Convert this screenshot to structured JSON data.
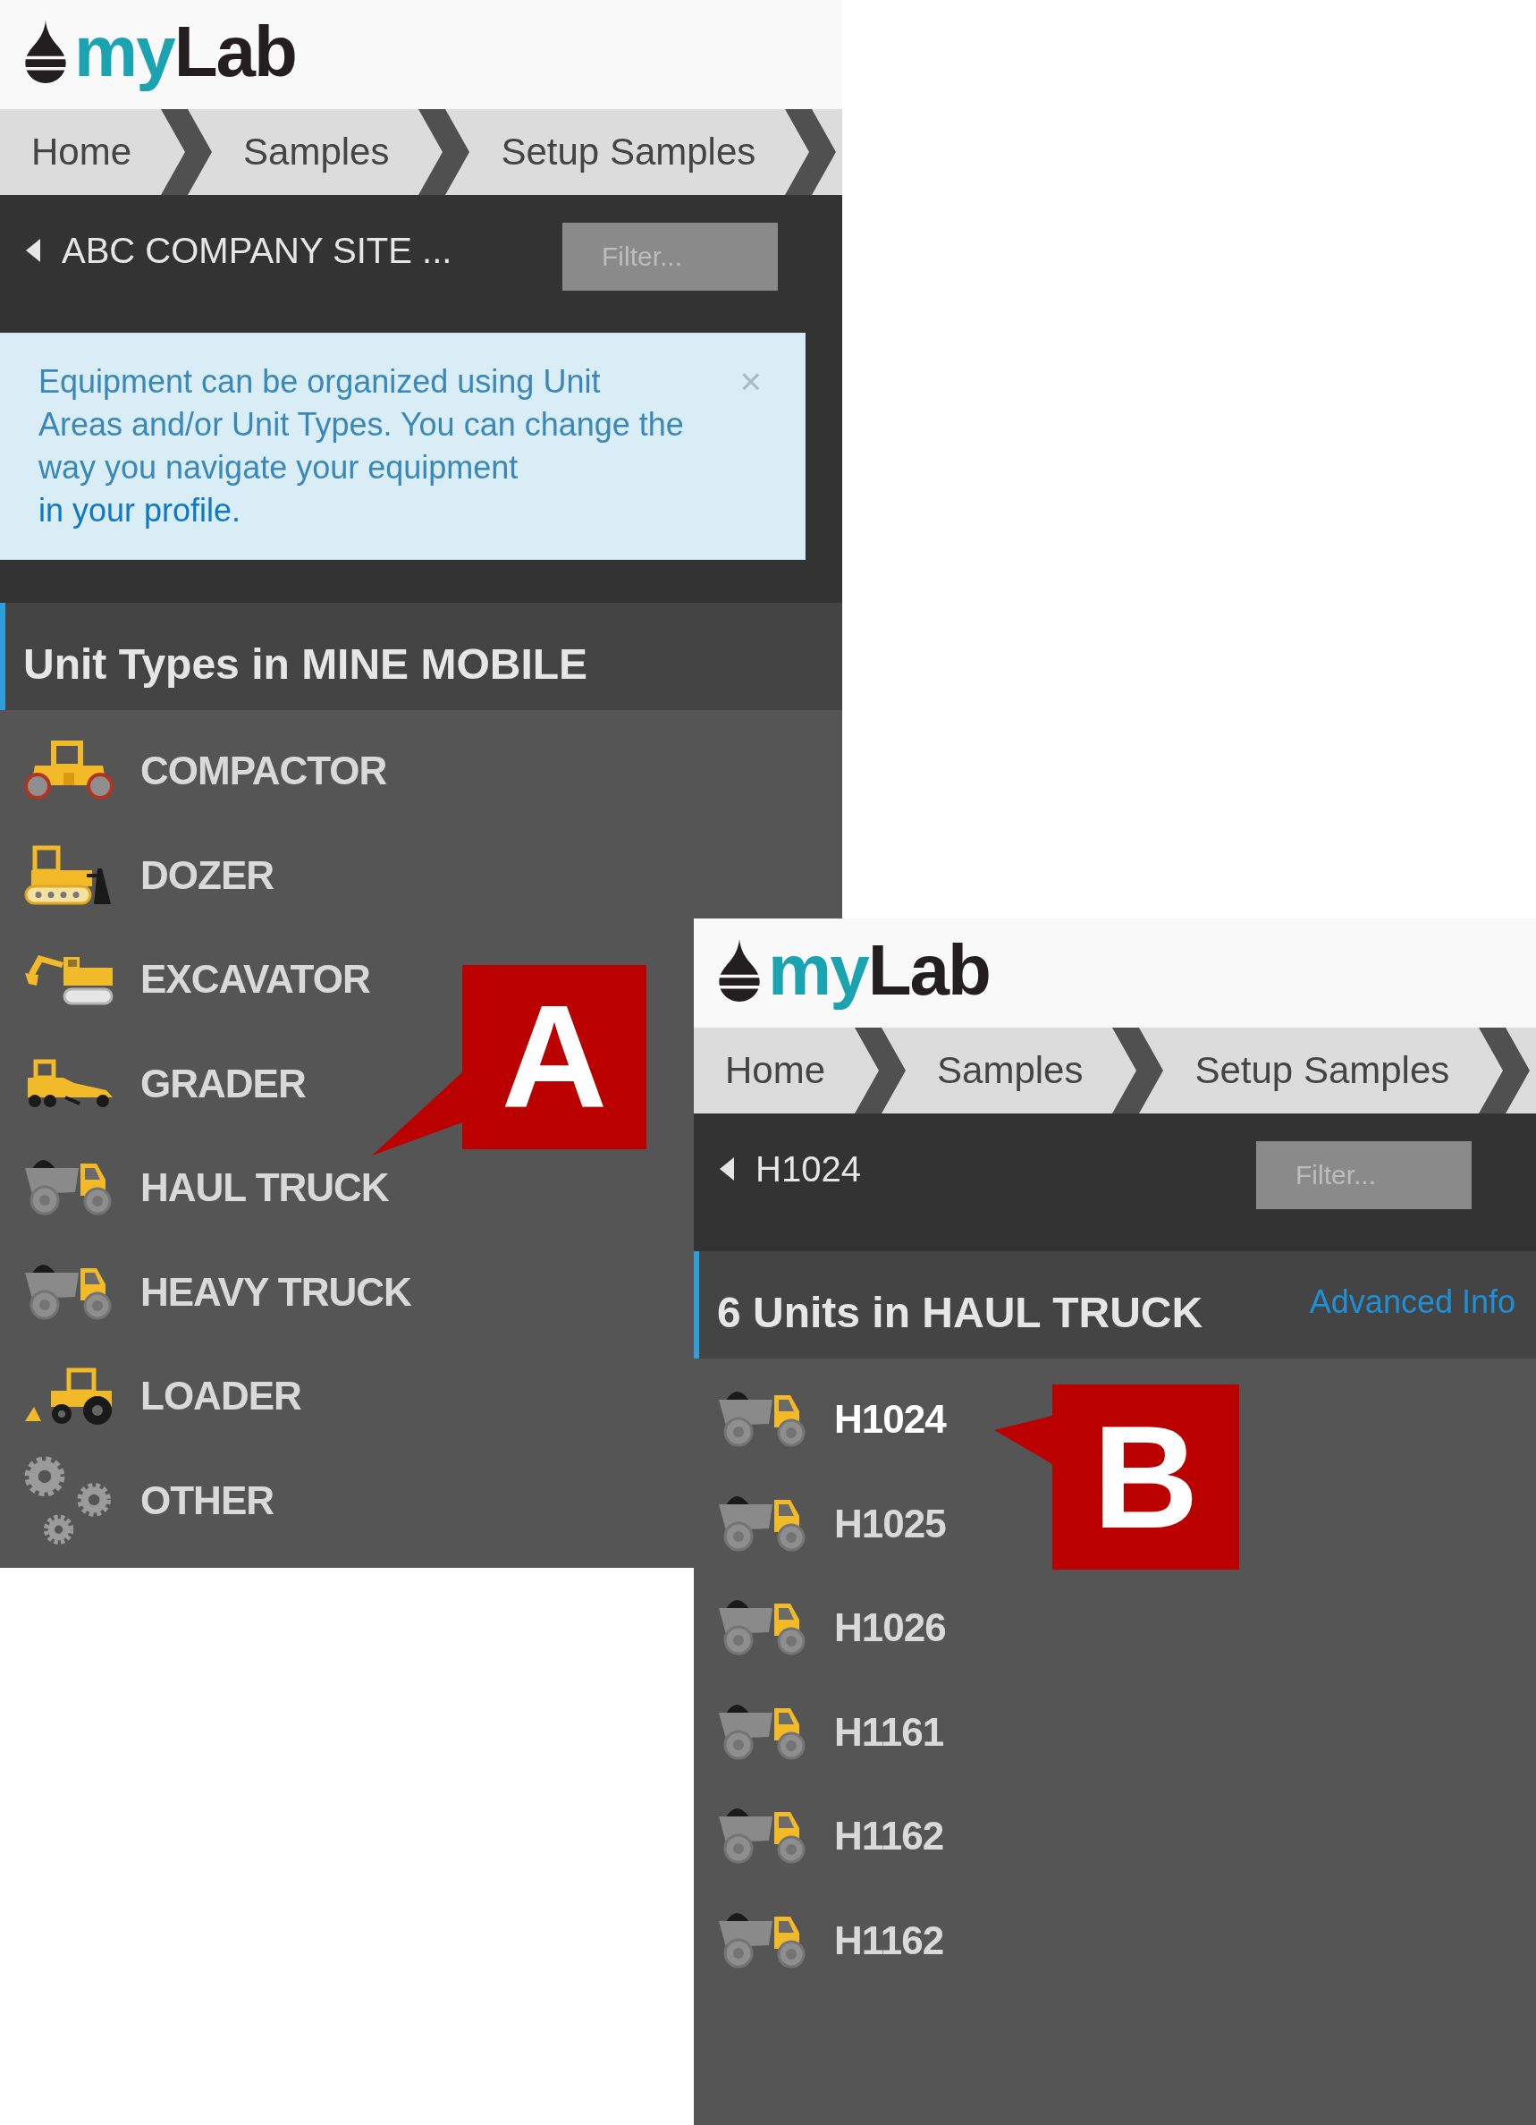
{
  "panels": [
    {
      "logo": {
        "prefix": "my",
        "name": "Lab"
      },
      "breadcrumb": [
        "Home",
        "Samples",
        "Setup Samples"
      ],
      "back_link": "ABC COMPANY SITE ...",
      "filter": {
        "placeholder": "Filter..."
      },
      "info": {
        "text": "Equipment can be organized using Unit Areas and/or Unit Types. You can change the way you navigate your equipment",
        "link": "in your profile.",
        "close": "×"
      },
      "list_header": {
        "title": "Unit Types in MINE MOBILE"
      },
      "items": [
        {
          "label": "COMPACTOR",
          "kind": "compactor",
          "selected": false
        },
        {
          "label": "DOZER",
          "kind": "dozer",
          "selected": false
        },
        {
          "label": "EXCAVATOR",
          "kind": "excavator",
          "selected": false
        },
        {
          "label": "GRADER",
          "kind": "grader",
          "selected": false
        },
        {
          "label": "HAUL TRUCK",
          "kind": "truck",
          "selected": false
        },
        {
          "label": "HEAVY TRUCK",
          "kind": "truck",
          "selected": false
        },
        {
          "label": "LOADER",
          "kind": "loader",
          "selected": false
        },
        {
          "label": "OTHER",
          "kind": "gears",
          "selected": false
        }
      ]
    },
    {
      "logo": {
        "prefix": "my",
        "name": "Lab"
      },
      "breadcrumb": [
        "Home",
        "Samples",
        "Setup Samples"
      ],
      "back_link": "H1024",
      "filter": {
        "placeholder": "Filter..."
      },
      "list_header": {
        "title": "6 Units in HAUL TRUCK",
        "link": "Advanced Info"
      },
      "items": [
        {
          "label": "H1024",
          "kind": "truck",
          "selected": true
        },
        {
          "label": "H1025",
          "kind": "truck",
          "selected": false
        },
        {
          "label": "H1026",
          "kind": "truck",
          "selected": false
        },
        {
          "label": "H1161",
          "kind": "truck",
          "selected": false
        },
        {
          "label": "H1162",
          "kind": "truck",
          "selected": false
        },
        {
          "label": "H1162",
          "kind": "truck",
          "selected": false
        }
      ]
    }
  ],
  "callouts": [
    {
      "letter": "A"
    },
    {
      "letter": "B"
    }
  ]
}
